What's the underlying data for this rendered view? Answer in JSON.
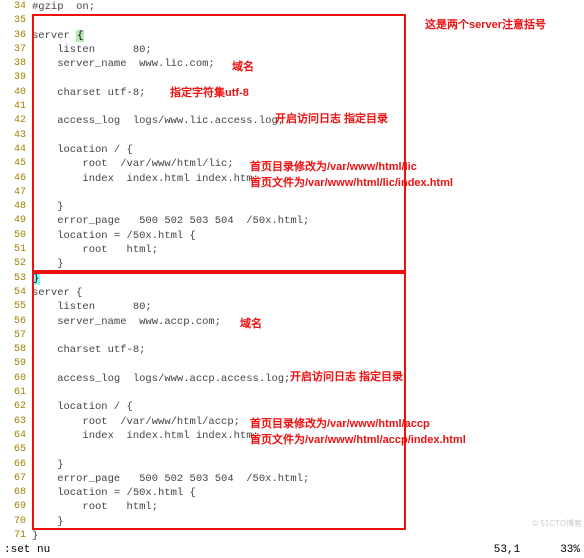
{
  "annotations": {
    "top_note": "这是两个server注意括号",
    "domain1": "域名",
    "charset_note": "指定字符集utf-8",
    "access_log_note": "开启访问日志  指定目录",
    "root_note1": "首页目录修改为/var/www/html/lic",
    "index_note1": "首页文件为/var/www/html/lic/index.html",
    "domain2": "域名",
    "access_log_note2": "开启访问日志  指定目录",
    "root_note2": "首页目录修改为/var/www/html/accp",
    "index_note2": "首页文件为/var/www/html/accp/index.html"
  },
  "lines": {
    "l34": "#gzip  on;",
    "l36": "server ",
    "l36b": "{",
    "l37": "    listen      80;",
    "l38": "    server_name  www.lic.com;",
    "l40": "    charset utf-8;",
    "l42": "    access_log  logs/www.lic.access.log;",
    "l44": "    location / {",
    "l45": "        root  /var/www/html/lic;",
    "l46": "        index  index.html index.htm;",
    "l48": "    }",
    "l49": "    error_page   500 502 503 504  /50x.html;",
    "l50": "    location = /50x.html {",
    "l51": "        root   html;",
    "l52": "    }",
    "l53": "}",
    "l54": "server {",
    "l55": "    listen      80;",
    "l56": "    server_name  www.accp.com;",
    "l58": "    charset utf-8;",
    "l60": "    access_log  logs/www.accp.access.log;",
    "l62": "    location / {",
    "l63": "        root  /var/www/html/accp;",
    "l64": "        index  index.html index.htm;",
    "l66": "    }",
    "l67": "    error_page   500 502 503 504  /50x.html;",
    "l68": "    location = /50x.html {",
    "l69": "        root   html;",
    "l70": "    }",
    "l71": "}"
  },
  "line_numbers": {
    "n34": "34",
    "n35": "35",
    "n36": "36",
    "n37": "37",
    "n38": "38",
    "n39": "39",
    "n40": "40",
    "n41": "41",
    "n42": "42",
    "n43": "43",
    "n44": "44",
    "n45": "45",
    "n46": "46",
    "n47": "47",
    "n48": "48",
    "n49": "49",
    "n50": "50",
    "n51": "51",
    "n52": "52",
    "n53": "53",
    "n54": "54",
    "n55": "55",
    "n56": "56",
    "n57": "57",
    "n58": "58",
    "n59": "59",
    "n60": "60",
    "n61": "61",
    "n62": "62",
    "n63": "63",
    "n64": "64",
    "n65": "65",
    "n66": "66",
    "n67": "67",
    "n68": "68",
    "n69": "69",
    "n70": "70",
    "n71": "71"
  },
  "status": {
    "left": ":set nu",
    "pos": "53,1",
    "pct": "33%"
  },
  "watermark": "© 51CTO博客"
}
